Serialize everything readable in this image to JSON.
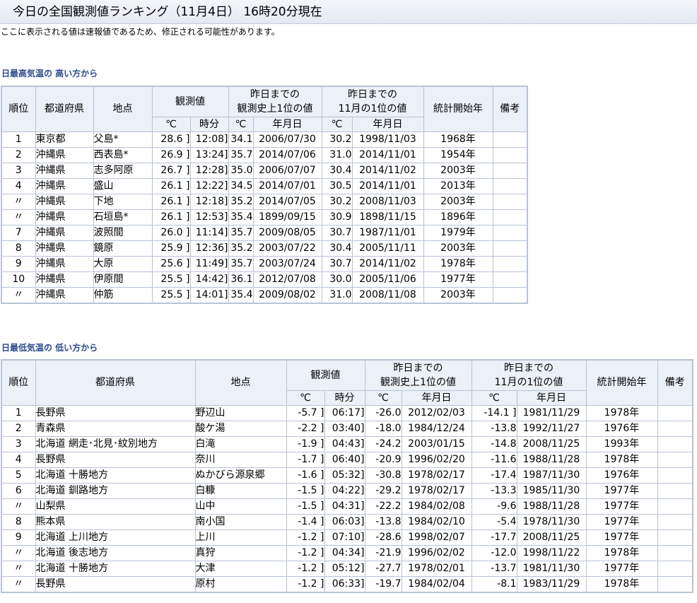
{
  "title": "今日の全国観測値ランキング（11月4日） 16時20分現在",
  "notice": "ここに表示される値は速報値であるため、修正される可能性があります。",
  "headers": {
    "rank": "順位",
    "pref": "都道府県",
    "place": "地点",
    "obs": "観測値",
    "hist_line1": "昨日までの",
    "hist_line2": "観測史上1位の値",
    "month_line1": "昨日までの",
    "month_line2": "11月の1位の値",
    "start": "統計開始年",
    "note": "備考",
    "celsius": "℃",
    "time": "時分",
    "date": "年月日"
  },
  "high": {
    "heading": "日最高気温の 高い方から",
    "rows": [
      {
        "rank": "1",
        "pref": "東京都",
        "place": "父島*",
        "obs_c": "28.6 ]",
        "obs_time": "12:08]",
        "hist_c": "34.1",
        "hist_date": "2006/07/30",
        "mon_c": "30.2",
        "mon_date": "1998/11/03",
        "start": "1968年",
        "note": ""
      },
      {
        "rank": "2",
        "pref": "沖縄県",
        "place": "西表島*",
        "obs_c": "26.9 ]",
        "obs_time": "13:24]",
        "hist_c": "35.7",
        "hist_date": "2014/07/06",
        "mon_c": "31.0",
        "mon_date": "2014/11/01",
        "start": "1954年",
        "note": ""
      },
      {
        "rank": "3",
        "pref": "沖縄県",
        "place": "志多阿原",
        "obs_c": "26.7 ]",
        "obs_time": "12:28]",
        "hist_c": "35.0",
        "hist_date": "2006/07/07",
        "mon_c": "30.4",
        "mon_date": "2014/11/02",
        "start": "2003年",
        "note": ""
      },
      {
        "rank": "4",
        "pref": "沖縄県",
        "place": "盛山",
        "obs_c": "26.1 ]",
        "obs_time": "12:22]",
        "hist_c": "34.5",
        "hist_date": "2014/07/01",
        "mon_c": "30.5",
        "mon_date": "2014/11/01",
        "start": "2013年",
        "note": ""
      },
      {
        "rank": "〃",
        "pref": "沖縄県",
        "place": "下地",
        "obs_c": "26.1 ]",
        "obs_time": "12:18]",
        "hist_c": "35.2",
        "hist_date": "2014/07/05",
        "mon_c": "30.2",
        "mon_date": "2008/11/03",
        "start": "2003年",
        "note": ""
      },
      {
        "rank": "〃",
        "pref": "沖縄県",
        "place": "石垣島*",
        "obs_c": "26.1 ]",
        "obs_time": "12:53]",
        "hist_c": "35.4",
        "hist_date": "1899/09/15",
        "mon_c": "30.9",
        "mon_date": "1898/11/15",
        "start": "1896年",
        "note": ""
      },
      {
        "rank": "7",
        "pref": "沖縄県",
        "place": "波照間",
        "obs_c": "26.0 ]",
        "obs_time": "11:14]",
        "hist_c": "35.7",
        "hist_date": "2009/08/05",
        "mon_c": "30.7",
        "mon_date": "1987/11/01",
        "start": "1979年",
        "note": ""
      },
      {
        "rank": "8",
        "pref": "沖縄県",
        "place": "鏡原",
        "obs_c": "25.9 ]",
        "obs_time": "12:36]",
        "hist_c": "35.2",
        "hist_date": "2003/07/22",
        "mon_c": "30.4",
        "mon_date": "2005/11/11",
        "start": "2003年",
        "note": ""
      },
      {
        "rank": "9",
        "pref": "沖縄県",
        "place": "大原",
        "obs_c": "25.6 ]",
        "obs_time": "11:49]",
        "hist_c": "35.7",
        "hist_date": "2003/07/24",
        "mon_c": "30.7",
        "mon_date": "2014/11/02",
        "start": "1978年",
        "note": ""
      },
      {
        "rank": "10",
        "pref": "沖縄県",
        "place": "伊原間",
        "obs_c": "25.5 ]",
        "obs_time": "14:42]",
        "hist_c": "36.1",
        "hist_date": "2012/07/08",
        "mon_c": "30.0",
        "mon_date": "2005/11/06",
        "start": "1977年",
        "note": ""
      },
      {
        "rank": "〃",
        "pref": "沖縄県",
        "place": "仲筋",
        "obs_c": "25.5 ]",
        "obs_time": "14:01]",
        "hist_c": "35.4",
        "hist_date": "2009/08/02",
        "mon_c": "31.0",
        "mon_date": "2008/11/08",
        "start": "2003年",
        "note": ""
      }
    ]
  },
  "low": {
    "heading": "日最低気温の 低い方から",
    "rows": [
      {
        "rank": "1",
        "pref": "長野県",
        "place": "野辺山",
        "obs_c": "-5.7 ]",
        "obs_time": "06:17]",
        "hist_c": "-26.0",
        "hist_date": "2012/02/03",
        "mon_c": "-14.1 ]",
        "mon_date": "1981/11/29",
        "start": "1978年",
        "note": ""
      },
      {
        "rank": "2",
        "pref": "青森県",
        "place": "酸ケ湯",
        "obs_c": "-2.2 ]",
        "obs_time": "03:40]",
        "hist_c": "-18.0",
        "hist_date": "1984/12/24",
        "mon_c": "-13.8",
        "mon_date": "1992/11/27",
        "start": "1976年",
        "note": ""
      },
      {
        "rank": "3",
        "pref": "北海道 網走･北見･紋別地方",
        "place": "白滝",
        "obs_c": "-1.9 ]",
        "obs_time": "04:43]",
        "hist_c": "-24.2",
        "hist_date": "2003/01/15",
        "mon_c": "-14.8",
        "mon_date": "2008/11/25",
        "start": "1993年",
        "note": ""
      },
      {
        "rank": "4",
        "pref": "長野県",
        "place": "奈川",
        "obs_c": "-1.7 ]",
        "obs_time": "06:40]",
        "hist_c": "-20.9",
        "hist_date": "1996/02/20",
        "mon_c": "-11.6",
        "mon_date": "1988/11/28",
        "start": "1978年",
        "note": ""
      },
      {
        "rank": "5",
        "pref": "北海道 十勝地方",
        "place": "ぬかびら源泉郷",
        "obs_c": "-1.6 ]",
        "obs_time": "05:32]",
        "hist_c": "-30.8",
        "hist_date": "1978/02/17",
        "mon_c": "-17.4",
        "mon_date": "1987/11/30",
        "start": "1976年",
        "note": ""
      },
      {
        "rank": "6",
        "pref": "北海道 釧路地方",
        "place": "白糠",
        "obs_c": "-1.5 ]",
        "obs_time": "04:22]",
        "hist_c": "-29.2",
        "hist_date": "1978/02/17",
        "mon_c": "-13.3",
        "mon_date": "1985/11/30",
        "start": "1977年",
        "note": ""
      },
      {
        "rank": "〃",
        "pref": "山梨県",
        "place": "山中",
        "obs_c": "-1.5 ]",
        "obs_time": "04:31]",
        "hist_c": "-22.2",
        "hist_date": "1984/02/08",
        "mon_c": "-9.6",
        "mon_date": "1988/11/28",
        "start": "1977年",
        "note": ""
      },
      {
        "rank": "8",
        "pref": "熊本県",
        "place": "南小国",
        "obs_c": "-1.4 ]",
        "obs_time": "06:03]",
        "hist_c": "-13.8",
        "hist_date": "1984/02/10",
        "mon_c": "-5.4",
        "mon_date": "1978/11/30",
        "start": "1977年",
        "note": ""
      },
      {
        "rank": "9",
        "pref": "北海道 上川地方",
        "place": "上川",
        "obs_c": "-1.2 ]",
        "obs_time": "07:10]",
        "hist_c": "-28.6",
        "hist_date": "1998/02/07",
        "mon_c": "-17.7",
        "mon_date": "2008/11/25",
        "start": "1977年",
        "note": ""
      },
      {
        "rank": "〃",
        "pref": "北海道 後志地方",
        "place": "真狩",
        "obs_c": "-1.2 ]",
        "obs_time": "04:34]",
        "hist_c": "-21.9",
        "hist_date": "1996/02/02",
        "mon_c": "-12.0",
        "mon_date": "1998/11/22",
        "start": "1978年",
        "note": ""
      },
      {
        "rank": "〃",
        "pref": "北海道 十勝地方",
        "place": "大津",
        "obs_c": "-1.2 ]",
        "obs_time": "05:12]",
        "hist_c": "-27.7",
        "hist_date": "1978/02/01",
        "mon_c": "-13.7",
        "mon_date": "1981/11/30",
        "start": "1977年",
        "note": ""
      },
      {
        "rank": "〃",
        "pref": "長野県",
        "place": "原村",
        "obs_c": "-1.2 ]",
        "obs_time": "06:33]",
        "hist_c": "-19.7",
        "hist_date": "1984/02/04",
        "mon_c": "-8.1",
        "mon_date": "1983/11/29",
        "start": "1978年",
        "note": ""
      }
    ]
  }
}
